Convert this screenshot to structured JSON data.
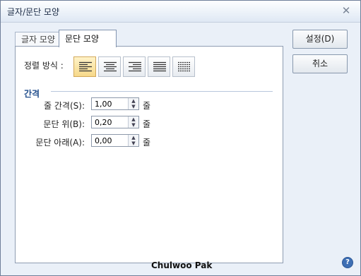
{
  "window": {
    "title": "글자/문단 모양"
  },
  "tabs": [
    {
      "label": "글자 모양"
    },
    {
      "label": "문단 모양"
    }
  ],
  "alignment": {
    "label": "정렬 방식 :",
    "options": [
      "left",
      "center",
      "right",
      "justify",
      "distribute"
    ],
    "selected": "left"
  },
  "spacing": {
    "section_label": "간격",
    "rows": [
      {
        "label": "줄 간격(S):",
        "value": "1,00",
        "unit": "줄"
      },
      {
        "label": "문단 위(B):",
        "value": "0,20",
        "unit": "줄"
      },
      {
        "label": "문단 아래(A):",
        "value": "0,00",
        "unit": "줄"
      }
    ]
  },
  "buttons": {
    "ok": "설정(D)",
    "cancel": "취소"
  },
  "footer": {
    "signature": "Chulwoo Pak",
    "help": "?"
  }
}
